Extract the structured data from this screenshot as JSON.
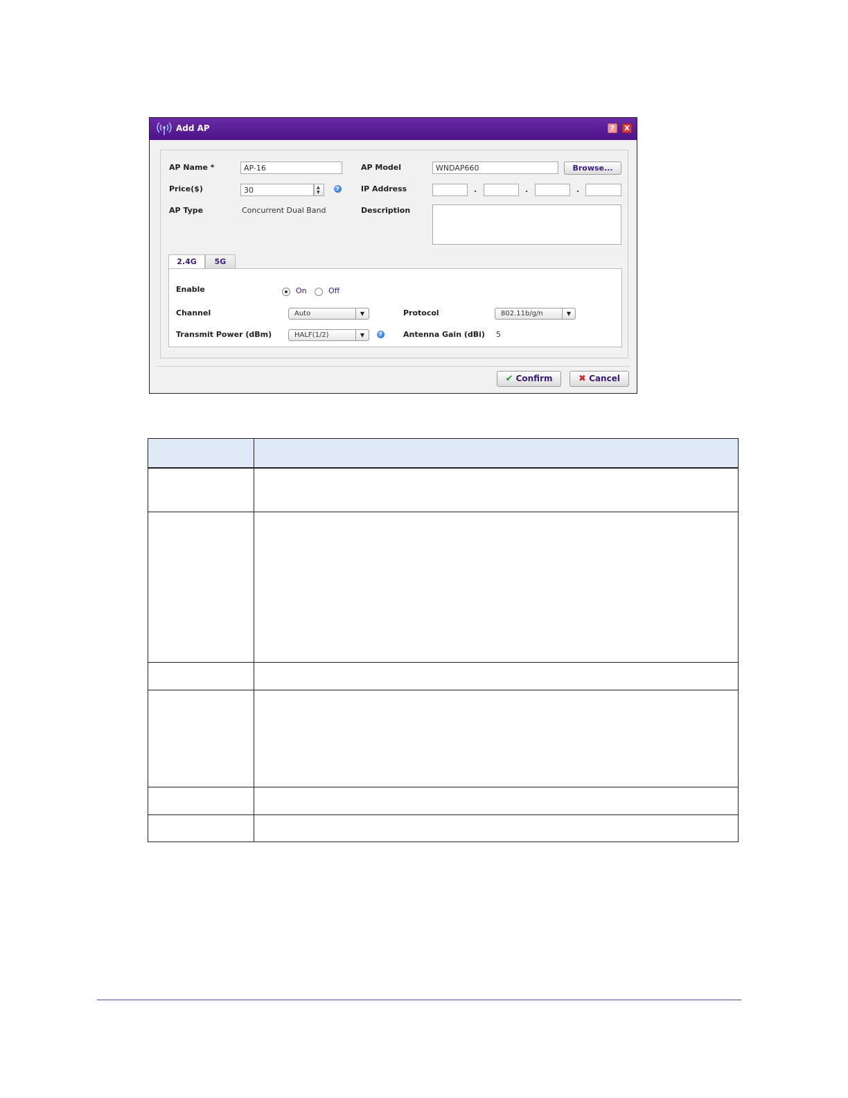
{
  "dialog": {
    "title": "Add AP",
    "help_glyph": "?",
    "close_glyph": "X",
    "fields": {
      "ap_name_label": "AP Name *",
      "ap_name_value": "AP-16",
      "price_label": "Price($)",
      "price_value": "30",
      "ap_type_label": "AP Type",
      "ap_type_value": "Concurrent Dual Band",
      "ap_model_label": "AP Model",
      "ap_model_value": "WNDAP660",
      "browse_label": "Browse...",
      "ip_label": "IP Address",
      "ip_octets": [
        "",
        "",
        "",
        ""
      ],
      "ip_separator": ".",
      "description_label": "Description",
      "description_value": ""
    },
    "tabs": [
      {
        "label": "2.4G",
        "active": true
      },
      {
        "label": "5G",
        "active": false
      }
    ],
    "radio": {
      "enable_label": "Enable",
      "on_label": "On",
      "off_label": "Off",
      "selected": "On"
    },
    "radio_settings": {
      "channel_label": "Channel",
      "channel_value": "Auto",
      "protocol_label": "Protocol",
      "protocol_value": "802.11b/g/n",
      "transmit_power_label": "Transmit Power (dBm)",
      "transmit_power_value": "HALF(1/2)",
      "antenna_gain_label": "Antenna Gain (dBi)",
      "antenna_gain_value": "5"
    },
    "buttons": {
      "confirm_label": "Confirm",
      "cancel_label": "Cancel"
    }
  },
  "colors": {
    "titlebar": "#5a1f98",
    "accent_text": "#3a1c7a",
    "table_header": "#dfe9f5",
    "footer_rule": "#7a3c8c"
  },
  "icons": [
    "antenna-icon",
    "help-icon",
    "close-icon",
    "spinner-up-icon",
    "spinner-down-icon",
    "dropdown-arrow-icon",
    "checkmark-icon",
    "cross-icon"
  ]
}
